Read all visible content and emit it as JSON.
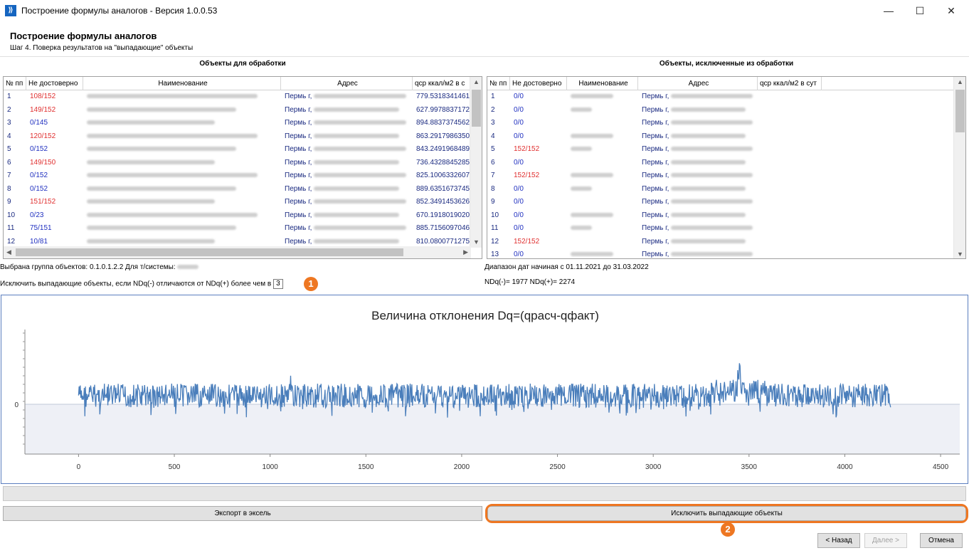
{
  "window": {
    "title": "Построение формулы аналогов - Версия 1.0.0.53",
    "minimize": "—",
    "maximize": "☐",
    "close": "✕"
  },
  "header": {
    "title": "Построение формулы аналогов",
    "subtitle": "Шаг 4. Поверка результатов на \"выпадающие\" объекты"
  },
  "left_panel": {
    "title": "Объекты для обработки",
    "columns": [
      "№ пп",
      "Не достоверно",
      "Наименование",
      "Адрес",
      "qср ккал/м2 в с"
    ],
    "rows": [
      {
        "n": "1",
        "nd": "108/152",
        "status": "red",
        "addr": "Пермь г,",
        "q": "779.5318341461"
      },
      {
        "n": "2",
        "nd": "149/152",
        "status": "red",
        "addr": "Пермь г,",
        "q": "627.9978837172"
      },
      {
        "n": "3",
        "nd": "0/145",
        "status": "blue",
        "addr": "Пермь г,",
        "q": "894.8837374562"
      },
      {
        "n": "4",
        "nd": "120/152",
        "status": "red",
        "addr": "Пермь г,",
        "q": "863.2917986350"
      },
      {
        "n": "5",
        "nd": "0/152",
        "status": "blue",
        "addr": "Пермь г,",
        "q": "843.2491968489"
      },
      {
        "n": "6",
        "nd": "149/150",
        "status": "red",
        "addr": "Пермь г,",
        "q": "736.4328845285"
      },
      {
        "n": "7",
        "nd": "0/152",
        "status": "blue",
        "addr": "Пермь г,",
        "q": "825.1006332607"
      },
      {
        "n": "8",
        "nd": "0/152",
        "status": "blue",
        "addr": "Пермь г,",
        "q": "889.6351673745"
      },
      {
        "n": "9",
        "nd": "151/152",
        "status": "red",
        "addr": "Пермь г,",
        "q": "852.3491453626"
      },
      {
        "n": "10",
        "nd": "0/23",
        "status": "blue",
        "addr": "Пермь г,",
        "q": "670.1918019020"
      },
      {
        "n": "11",
        "nd": "75/151",
        "status": "blue",
        "addr": "Пермь г,",
        "q": "885.7156097046"
      },
      {
        "n": "12",
        "nd": "10/81",
        "status": "blue",
        "addr": "Пермь г,",
        "q": "810.0800771275"
      }
    ]
  },
  "right_panel": {
    "title": "Объекты, исключенные из обработки",
    "columns": [
      "№ пп",
      "Не достоверно",
      "Наименование",
      "Адрес",
      "qср ккал/м2 в сут"
    ],
    "rows": [
      {
        "n": "1",
        "nd": "0/0",
        "status": "blue",
        "addr": "Пермь г,"
      },
      {
        "n": "2",
        "nd": "0/0",
        "status": "blue",
        "addr": "Пермь г,"
      },
      {
        "n": "3",
        "nd": "0/0",
        "status": "blue",
        "addr": "Пермь г,"
      },
      {
        "n": "4",
        "nd": "0/0",
        "status": "blue",
        "addr": "Пермь г,"
      },
      {
        "n": "5",
        "nd": "152/152",
        "status": "red",
        "addr": "Пермь г,"
      },
      {
        "n": "6",
        "nd": "0/0",
        "status": "blue",
        "addr": "Пермь г,"
      },
      {
        "n": "7",
        "nd": "152/152",
        "status": "red",
        "addr": "Пермь г,"
      },
      {
        "n": "8",
        "nd": "0/0",
        "status": "blue",
        "addr": "Пермь г,"
      },
      {
        "n": "9",
        "nd": "0/0",
        "status": "blue",
        "addr": "Пермь г,"
      },
      {
        "n": "10",
        "nd": "0/0",
        "status": "blue",
        "addr": "Пермь г,"
      },
      {
        "n": "11",
        "nd": "0/0",
        "status": "blue",
        "addr": "Пермь г,"
      },
      {
        "n": "12",
        "nd": "152/152",
        "status": "red",
        "addr": "Пермь г,"
      },
      {
        "n": "13",
        "nd": "0/0",
        "status": "blue",
        "addr": "Пермь г,"
      }
    ]
  },
  "info": {
    "group": "Выбрана группа объектов: 0.1.0.1.2.2   Для т/системы:",
    "exclude_label": "Исключить выпадающие объекты, если NDq(-) отличаются от NDq(+) более чем в",
    "exclude_value": "3",
    "date_range": "Диапазон дат начиная с 01.11.2021 до 31.03.2022",
    "ndq": "NDq(-)= 1977  NDq(+)= 2274"
  },
  "badges": {
    "one": "1",
    "two": "2"
  },
  "chart_data": {
    "type": "line",
    "title": "Величина отклонения Dq=(qрасч-qфакт)",
    "xlabel": "",
    "ylabel": "",
    "xlim": [
      -280,
      4600
    ],
    "x_ticks": [
      "0",
      "500",
      "1000",
      "1500",
      "2000",
      "2500",
      "3000",
      "3500",
      "4000",
      "4500"
    ],
    "y_ticks": [
      "0"
    ],
    "n_points": 4240,
    "series_color": "#4a7ebb",
    "negative_fill": "#eef0f6"
  },
  "buttons": {
    "export": "Экспорт в эксель",
    "exclude": "Исключить выпадающие объекты",
    "back": "< Назад",
    "next": "Далее >",
    "cancel": "Отмена"
  }
}
